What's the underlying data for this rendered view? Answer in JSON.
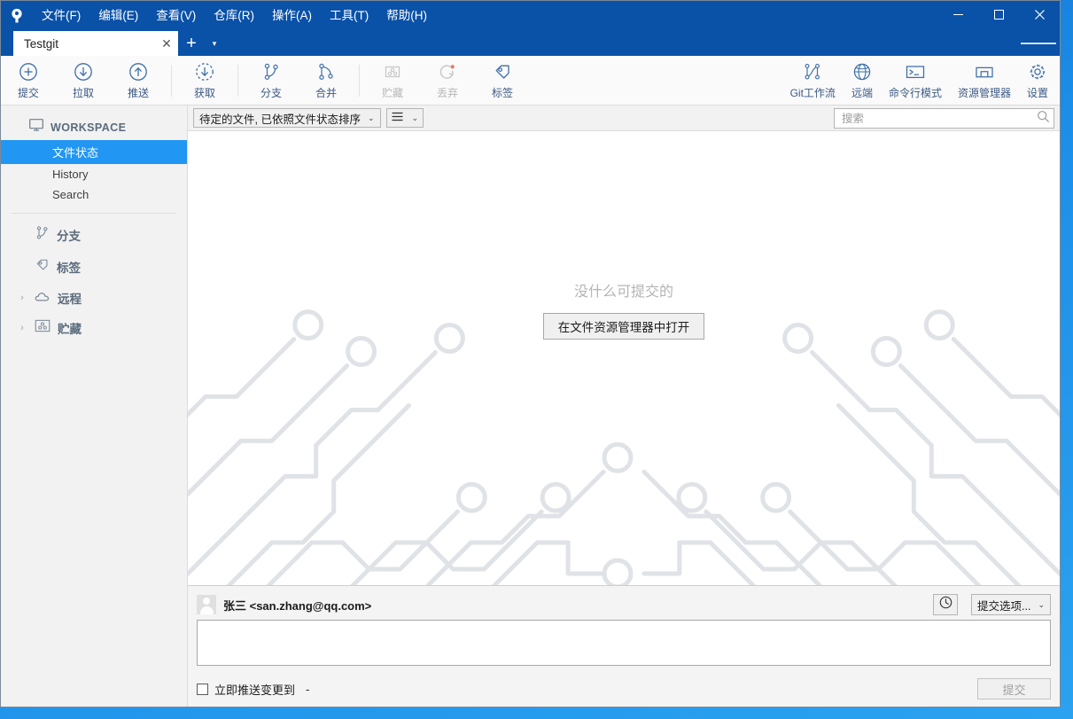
{
  "window": {
    "menu": [
      "文件(F)",
      "编辑(E)",
      "查看(V)",
      "仓库(R)",
      "操作(A)",
      "工具(T)",
      "帮助(H)"
    ],
    "controls": {
      "minimize": "—",
      "maximize": "□",
      "close": "✕"
    }
  },
  "tabs": {
    "items": [
      {
        "label": "Testgit",
        "close": "✕"
      }
    ],
    "add": "+",
    "dropdown": "▾"
  },
  "toolbar": {
    "left": [
      {
        "name": "commit",
        "label": "提交",
        "icon": "plus-circle-icon",
        "disabled": false
      },
      {
        "name": "pull",
        "label": "拉取",
        "icon": "arrow-down-circle-icon",
        "disabled": false
      },
      {
        "name": "push",
        "label": "推送",
        "icon": "arrow-up-circle-icon",
        "disabled": false
      },
      {
        "name": "fetch",
        "label": "获取",
        "icon": "arrow-down-dashed-icon",
        "disabled": false
      },
      {
        "name": "branch",
        "label": "分支",
        "icon": "branch-icon",
        "disabled": false
      },
      {
        "name": "merge",
        "label": "合并",
        "icon": "merge-icon",
        "disabled": false
      },
      {
        "name": "stash",
        "label": "贮藏",
        "icon": "stash-icon",
        "disabled": true
      },
      {
        "name": "discard",
        "label": "丢弃",
        "icon": "discard-icon",
        "disabled": true
      },
      {
        "name": "tag",
        "label": "标签",
        "icon": "tag-icon",
        "disabled": false
      }
    ],
    "right": [
      {
        "name": "gitflow",
        "label": "Git工作流",
        "icon": "gitflow-icon"
      },
      {
        "name": "remote",
        "label": "远端",
        "icon": "globe-icon"
      },
      {
        "name": "terminal",
        "label": "命令行模式",
        "icon": "terminal-icon"
      },
      {
        "name": "explorer",
        "label": "资源管理器",
        "icon": "folder-icon"
      },
      {
        "name": "settings",
        "label": "设置",
        "icon": "gear-icon"
      }
    ]
  },
  "sidebar": {
    "workspace": {
      "label": "WORKSPACE",
      "icon": "monitor-icon"
    },
    "workspace_items": [
      {
        "label": "文件状态",
        "active": true
      },
      {
        "label": "History",
        "active": false
      },
      {
        "label": "Search",
        "active": false
      }
    ],
    "groups": [
      {
        "label": "分支",
        "icon": "branch-icon",
        "caret": ""
      },
      {
        "label": "标签",
        "icon": "tag-icon",
        "caret": ""
      },
      {
        "label": "远程",
        "icon": "cloud-icon",
        "caret": "›"
      },
      {
        "label": "贮藏",
        "icon": "stash-icon",
        "caret": "›"
      }
    ]
  },
  "filterbar": {
    "sort_combo": "待定的文件, 已依照文件状态排序",
    "view_combo_icon": "list-view-icon",
    "chevron": "⌄",
    "search_placeholder": "搜索",
    "search_value": "",
    "search_icon": "search-icon"
  },
  "main": {
    "empty_title": "没什么可提交的",
    "open_explorer_button": "在文件资源管理器中打开"
  },
  "commit": {
    "user": "张三 <san.zhang@qq.com>",
    "history_icon": "clock-icon",
    "options_button": "提交选项...",
    "options_chevron": "⌄",
    "message_value": "",
    "push_checkbox_label": "立即推送变更到",
    "push_target": "-",
    "push_checked": false,
    "commit_button": "提交",
    "commit_button_enabled": false
  },
  "colors": {
    "titlebar": "#0a51a8",
    "accent": "#2196f3",
    "toolbar_icon": "#3c6fa8",
    "toolbar_label": "#3c5a85",
    "disabled": "#b7b7b7",
    "circuit": "#dfe2e6"
  }
}
